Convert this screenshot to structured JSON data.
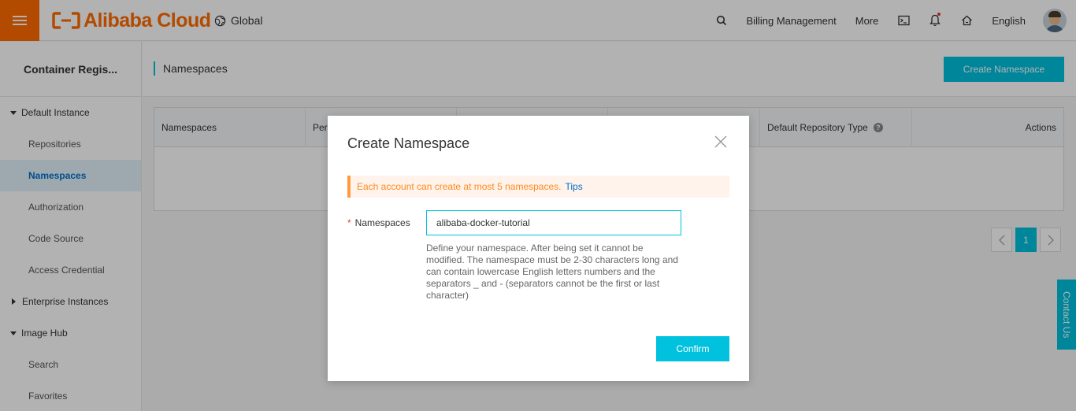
{
  "topbar": {
    "brand": "Alibaba Cloud",
    "region": "Global",
    "billing": "Billing Management",
    "more": "More",
    "language": "English",
    "accent": "#ff6a00"
  },
  "sidebar": {
    "title": "Container Regis...",
    "groups": [
      {
        "label": "Default Instance",
        "expanded": true
      },
      {
        "label": "Enterprise Instances",
        "expanded": false
      },
      {
        "label": "Image Hub",
        "expanded": true
      }
    ],
    "items": [
      {
        "label": "Repositories"
      },
      {
        "label": "Namespaces",
        "active": true
      },
      {
        "label": "Authorization"
      },
      {
        "label": "Code Source"
      },
      {
        "label": "Access Credential"
      },
      {
        "label": "Search"
      },
      {
        "label": "Favorites"
      }
    ]
  },
  "main": {
    "title": "Namespaces",
    "create_button": "Create Namespace",
    "table": {
      "headers": [
        "Namespaces",
        "Per",
        "",
        "",
        "Default Repository Type",
        "Actions"
      ]
    },
    "pager": {
      "current": "1"
    },
    "contact": "Contact Us"
  },
  "modal": {
    "title": "Create Namespace",
    "notice": "Each account can create at most 5 namespaces.",
    "notice_link": "Tips",
    "field_label": "Namespaces",
    "field_value": "alibaba-docker-tutorial",
    "help": "Define your namespace. After being set it cannot be modified. The namespace must be 2-30 characters long and can contain lowercase English letters numbers and the separators _ and - (separators cannot be the first or last character)",
    "confirm": "Confirm"
  },
  "colors": {
    "primary": "#00c1de",
    "warning": "#ff8a1d",
    "link": "#0070cc"
  },
  "icons": [
    "menu-icon",
    "alibaba-logo-icon",
    "globe-icon",
    "search-icon",
    "terminal-icon",
    "bell-icon",
    "home-icon",
    "help-icon",
    "close-icon",
    "chevron-left-icon",
    "chevron-right-icon"
  ]
}
